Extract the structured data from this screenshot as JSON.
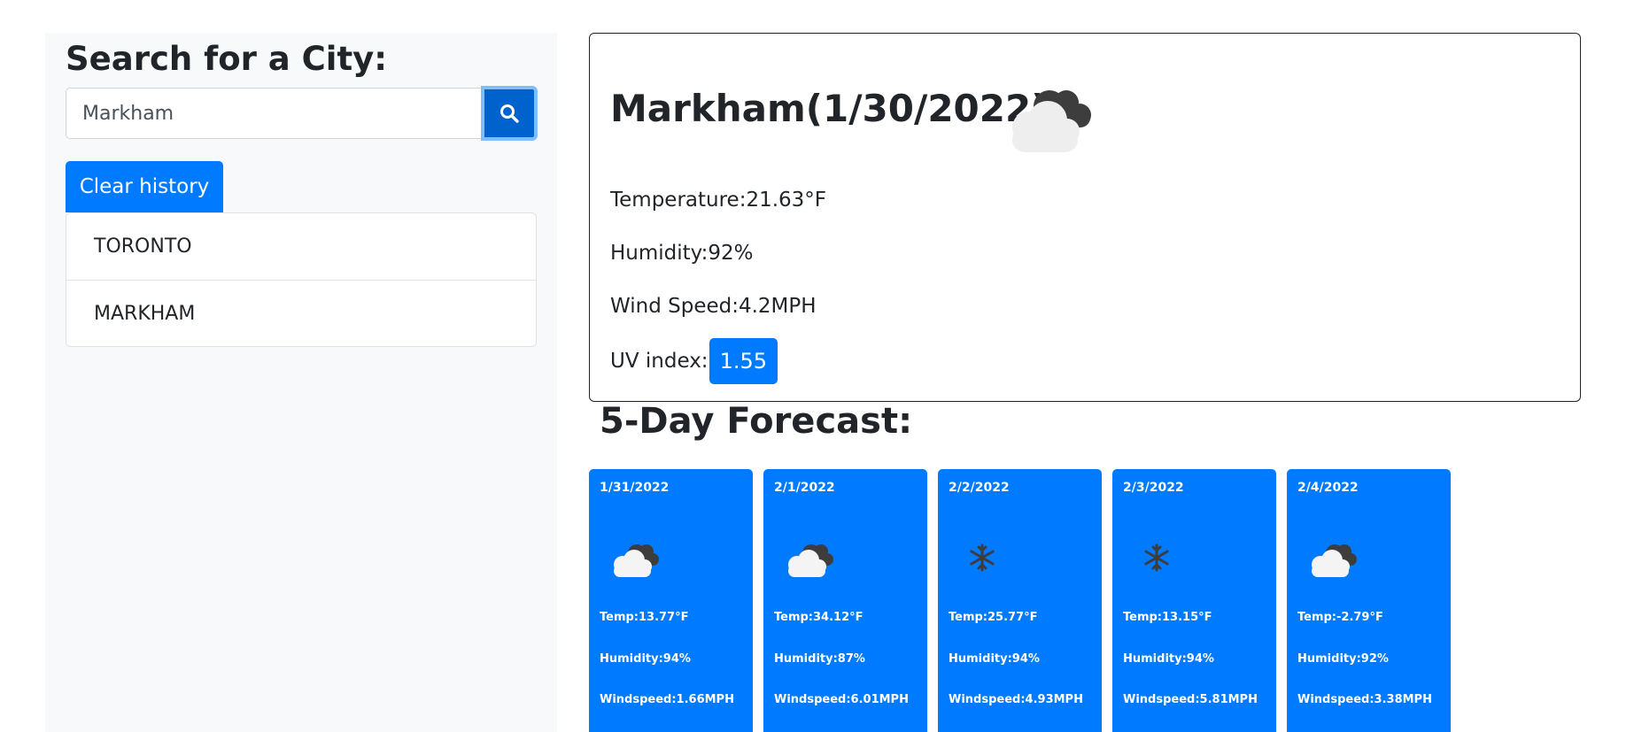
{
  "sidebar": {
    "title": "Search for a City:",
    "search_value": "Markham",
    "search_icon": "search-icon",
    "clear_label": "Clear history",
    "history": [
      {
        "label": "TORONTO"
      },
      {
        "label": "MARKHAM"
      }
    ]
  },
  "current": {
    "title": "Markham(1/30/2022)",
    "icon": "cloud-icon",
    "temperature_label": "Temperature:",
    "temperature_value": "21.63°F",
    "humidity_label": "Humidity:",
    "humidity_value": "92%",
    "wind_label": "Wind Speed:",
    "wind_value": "4.2MPH",
    "uv_label": "UV index:",
    "uv_value": "1.55"
  },
  "forecast": {
    "title": "5-Day Forecast:",
    "days": [
      {
        "date": "1/31/2022",
        "icon": "cloud-icon",
        "temp": "Temp:13.77°F",
        "humidity": "Humidity:94%",
        "wind": "Windspeed:1.66MPH"
      },
      {
        "date": "2/1/2022",
        "icon": "cloud-icon",
        "temp": "Temp:34.12°F",
        "humidity": "Humidity:87%",
        "wind": "Windspeed:6.01MPH"
      },
      {
        "date": "2/2/2022",
        "icon": "snowflake-icon",
        "temp": "Temp:25.77°F",
        "humidity": "Humidity:94%",
        "wind": "Windspeed:4.93MPH"
      },
      {
        "date": "2/3/2022",
        "icon": "snowflake-icon",
        "temp": "Temp:13.15°F",
        "humidity": "Humidity:94%",
        "wind": "Windspeed:5.81MPH"
      },
      {
        "date": "2/4/2022",
        "icon": "cloud-icon",
        "temp": "Temp:-2.79°F",
        "humidity": "Humidity:92%",
        "wind": "Windspeed:3.38MPH"
      }
    ]
  },
  "colors": {
    "primary": "#007bff",
    "primary_dark": "#0062cc",
    "sidebar_bg": "#f8f9fa",
    "text": "#212529"
  }
}
